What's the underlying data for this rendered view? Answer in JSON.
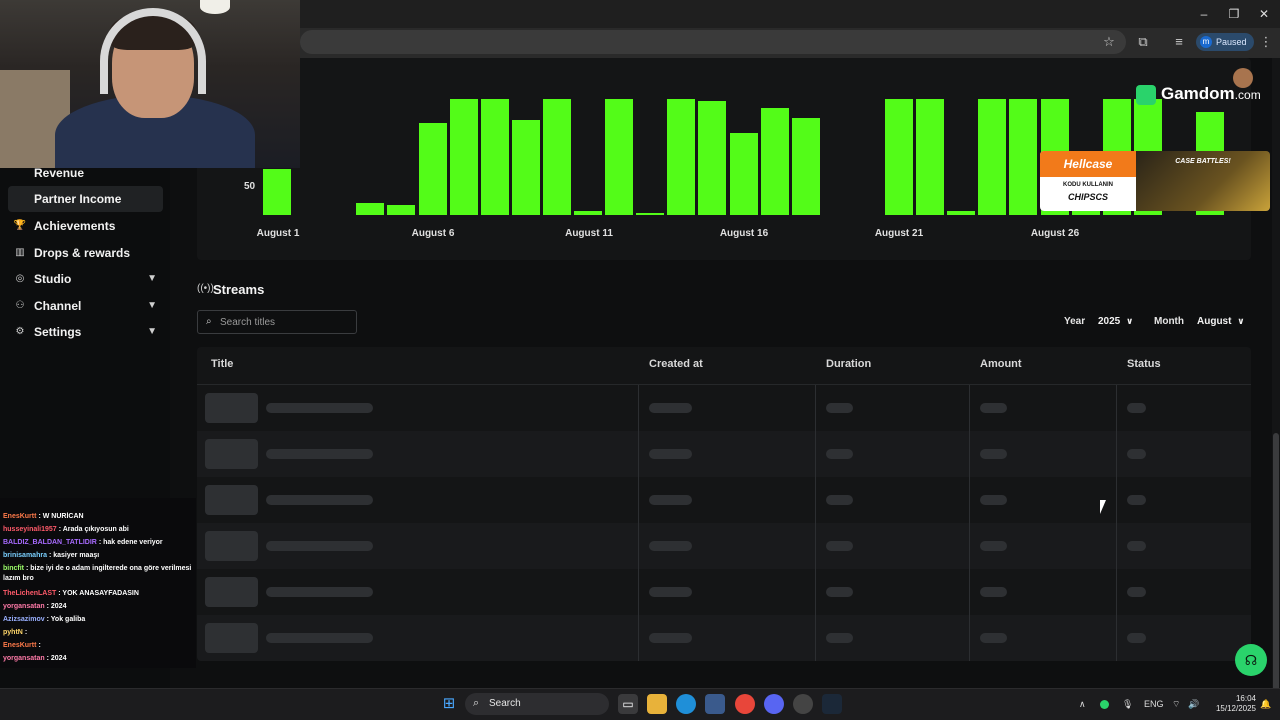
{
  "browser": {
    "paused_label": "Paused",
    "profile_initial": "m"
  },
  "sidebar": {
    "items": [
      {
        "label": "Revenue",
        "icon": "none"
      },
      {
        "label": "Partner Income",
        "icon": "none"
      },
      {
        "label": "Achievements",
        "icon": "trophy-icon"
      },
      {
        "label": "Drops & rewards",
        "icon": "chart-icon"
      },
      {
        "label": "Studio",
        "icon": "studio-icon"
      },
      {
        "label": "Channel",
        "icon": "people-icon"
      },
      {
        "label": "Settings",
        "icon": "gear-icon"
      }
    ]
  },
  "chart_data": {
    "type": "bar",
    "ytick_label": "50",
    "xtick_labels": [
      "August 1",
      "August 6",
      "August 11",
      "August 16",
      "August 21",
      "August 26"
    ],
    "categories": [
      "Aug 1",
      "Aug 2",
      "Aug 3",
      "Aug 4",
      "Aug 5",
      "Aug 6",
      "Aug 7",
      "Aug 8",
      "Aug 9",
      "Aug 10",
      "Aug 11",
      "Aug 12",
      "Aug 13",
      "Aug 14",
      "Aug 15",
      "Aug 16",
      "Aug 17",
      "Aug 18",
      "Aug 19",
      "Aug 20",
      "Aug 21",
      "Aug 22",
      "Aug 23",
      "Aug 24",
      "Aug 25",
      "Aug 26",
      "Aug 27",
      "Aug 28",
      "Aug 29",
      "Aug 30",
      "Aug 31"
    ],
    "values": [
      46,
      0,
      0,
      12,
      10,
      92,
      116,
      116,
      95,
      116,
      4,
      116,
      2,
      116,
      114,
      82,
      107,
      97,
      0,
      0,
      116,
      116,
      4,
      116,
      116,
      116,
      60,
      116,
      116,
      0,
      103
    ],
    "bar_color": "#53fc18"
  },
  "streams": {
    "title": "Streams",
    "search_placeholder": "Search titles",
    "year_label": "Year",
    "year_value": "2025",
    "month_label": "Month",
    "month_value": "August",
    "columns": [
      "Title",
      "Created at",
      "Duration",
      "Amount",
      "Status"
    ]
  },
  "chat": [
    {
      "user": "EnesKurtt",
      "color": "#ff7a4a",
      "text": ": W NURİCAN"
    },
    {
      "user": "husseyinali1957",
      "color": "#ff5a6a",
      "text": ": Arada çıkıyosun abi"
    },
    {
      "user": "BALDIZ_BALDAN_TATLIDIR",
      "color": "#a86bff",
      "text": ": hak edene veriyor"
    },
    {
      "user": "brinisamahra",
      "color": "#7ad0ff",
      "text": ": kasiyer maaşı"
    },
    {
      "user": "bincfit",
      "color": "#9dff6a",
      "text": ": bize iyi de o adam ingilterede ona göre verilmesi lazım bro"
    },
    {
      "user": "TheLichenLAST",
      "color": "#ff5a6a",
      "text": ": YOK ANASAYFADASIN"
    },
    {
      "user": "yorgansatan",
      "color": "#ff7aa8",
      "text": ": 2024"
    },
    {
      "user": "Azizsazimov",
      "color": "#9ab0ff",
      "text": ": Yok galiba"
    },
    {
      "user": "pyhtN",
      "color": "#ffd66a",
      "text": ":"
    },
    {
      "user": "EnesKurtt",
      "color": "#ff7a4a",
      "text": ":"
    },
    {
      "user": "yorgansatan",
      "color": "#ff7aa8",
      "text": ": 2024"
    }
  ],
  "ads": {
    "gamdom_brand": "Gamdom",
    "gamdom_tld": ".com",
    "hellcase_brand": "Hellcase",
    "hellcase_line1": "KODU KULLANIN",
    "hellcase_code": "CHIPSCS",
    "hellcase_promo": "CASE BATTLES!"
  },
  "taskbar": {
    "search_label": "Search",
    "lang": "ENG",
    "time": "16:04",
    "date": "15/12/2025"
  }
}
